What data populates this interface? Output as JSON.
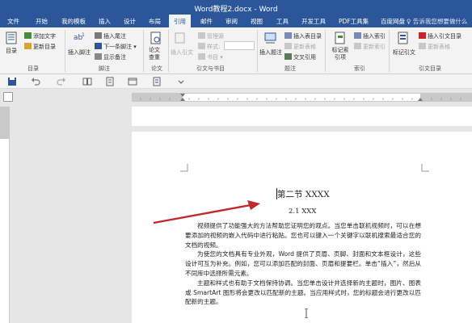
{
  "window": {
    "title": "Word教程2.docx - Word"
  },
  "tabs": [
    "文件",
    "开始",
    "我的模板",
    "插入",
    "设计",
    "布局",
    "引用",
    "邮件",
    "审阅",
    "视图",
    "工具",
    "开发工具",
    "PDF工具集",
    "百度网盘"
  ],
  "active_tab": "引用",
  "tell_me": "告诉我您想要做什么",
  "ribbon": {
    "toc": {
      "big": "目录",
      "add_text": "添加文字",
      "update": "更新目录",
      "group": "目录"
    },
    "footnote": {
      "insert_footnote": "插入脚注",
      "insert_endnote": "插入尾注",
      "next_footnote": "下一条脚注",
      "show_notes": "显示备注",
      "group": "脚注"
    },
    "research": {
      "paper_check": "论文查重",
      "group": "论文"
    },
    "citations": {
      "insert_citation": "插入引文",
      "manage_sources": "管理源",
      "style": "样式:",
      "bibliography": "书目",
      "group": "引文与书目"
    },
    "captions": {
      "insert_caption": "插入题注",
      "insert_table_of_figures": "插入表目录",
      "update_table": "更新表格",
      "cross_reference": "交叉引用",
      "group": "题注"
    },
    "index": {
      "mark_entry": "标记索引项",
      "insert_index": "插入索引",
      "update_index": "更新索引",
      "group": "索引"
    },
    "toa": {
      "mark_citation": "标记引文",
      "insert_toa": "插入引文目录",
      "update_toa": "更新表格",
      "group": "引文目录"
    }
  },
  "document": {
    "heading1": "第二节 XXXX",
    "heading2": "2.1 XXX",
    "paragraphs": [
      "视频提供了功能强大的方法帮助您证明您的观点。当您单击联机视频时，可以在想要添加的视频的嵌入代码中进行粘贴。您也可以键入一个关键字以联机搜索最适合您的文档的视频。",
      "为使您的文档具有专业外观，Word 提供了页眉、页脚、封面和文本框设计，这些设计可互为补充。例如，您可以添加匹配的封面、页眉和提要栏。单击“插入”，然后从不同库中选择所需元素。",
      "主题和样式也有助于文档保持协调。当您单击设计并选择新的主题时，图片、图表或 SmartArt 图形将会更改以匹配新的主题。当应用样式时，您的标题会进行更改以匹配新的主题。"
    ]
  },
  "colors": {
    "brand": "#2b579a",
    "arrow": "#c0282d"
  }
}
